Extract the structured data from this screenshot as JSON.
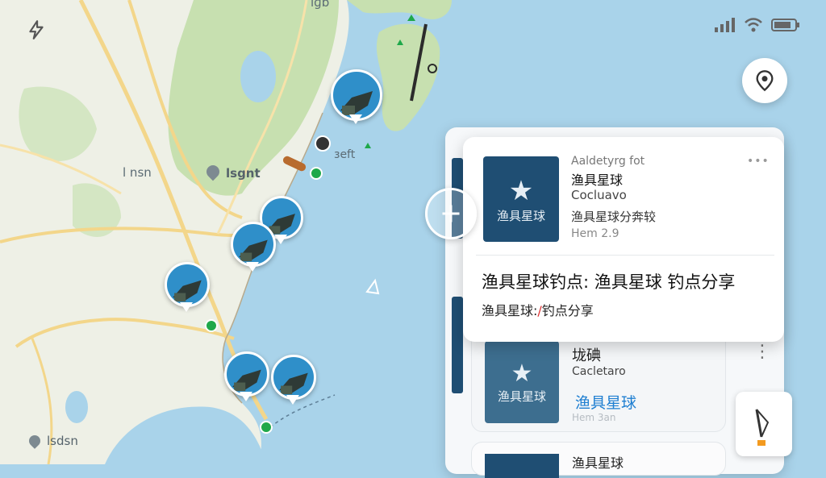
{
  "status_bar": {
    "signal_icon": "signal-icon",
    "wifi_icon": "wifi-icon",
    "battery_icon": "battery-icon"
  },
  "map": {
    "labels": {
      "top_fragment": "lɡb",
      "town_left": "l nsn",
      "poi_center": "lsgnt",
      "poi_small": "ɜeft",
      "bottom_left": "lsdsn"
    }
  },
  "popup": {
    "subtitle": "Aaldetyrg fot",
    "name": "渔具星球",
    "sub_name": "Cocluavo",
    "desc": "渔具星球分奔较",
    "meta": "Hem 2.9",
    "thumb_text": "渔具星球",
    "headline": "渔具星球钓点: 渔具星球 钓点分享",
    "snippet_prefix": "渔具星球:",
    "snippet_suffix": "钓点分享",
    "more_label": "•••"
  },
  "second_card": {
    "title": "垅碘",
    "sub": "Cacletaro",
    "thumb_text": "渔具星球",
    "link_text": "渔具星球",
    "faded": "Hem 3an",
    "more_label": "⋮"
  },
  "third_card": {
    "title_partial": "渔具星球"
  },
  "colors": {
    "accent": "#1f7fd1",
    "water": "#a9d3ea",
    "land": "#eef0e6",
    "green": "#c7e0b0",
    "road": "#f3d68a"
  }
}
